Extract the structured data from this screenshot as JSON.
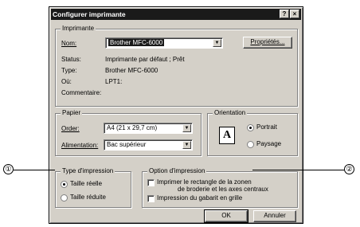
{
  "dialog": {
    "title": "Configurer imprimante",
    "help_btn": "?",
    "close_btn": "×"
  },
  "printer": {
    "group_title": "Imprimante",
    "name_label": "Nom:",
    "name_value": "Brother MFC-6000",
    "properties_btn": "Propriétés...",
    "status_label": "Status:",
    "status_value": "Imprimante par défaut ; Prêt",
    "type_label": "Type:",
    "type_value": "Brother MFC-6000",
    "where_label": "Où:",
    "where_value": "LPT1:",
    "comment_label": "Commentaire:"
  },
  "paper": {
    "group_title": "Papier",
    "order_label": "Order:",
    "order_value": "A4 (21 x 29,7 cm)",
    "feed_label": "Alimentation:",
    "feed_value": "Bac supérieur"
  },
  "orientation": {
    "group_title": "Orientation",
    "icon_letter": "A",
    "portrait": "Portrait",
    "landscape": "Paysage",
    "selected": "portrait"
  },
  "print_type": {
    "group_title": "Type d'impression",
    "actual_size": "Taille réelle",
    "reduced_size": "Taille réduite",
    "selected": "actual_size"
  },
  "print_option": {
    "group_title": "Option d'impression",
    "rect_line1": "Imprimer le rectangle de la zonen",
    "rect_line2": "de broderie et les axes centraux",
    "grid": "Impression du gabarit en grille"
  },
  "buttons": {
    "ok": "OK",
    "cancel": "Annuler"
  },
  "callouts": {
    "left": "①",
    "right": "②"
  }
}
